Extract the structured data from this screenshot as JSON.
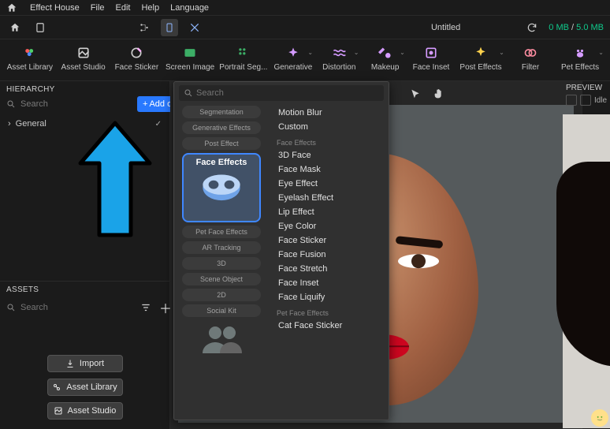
{
  "titlebar": {
    "app_name": "Effect House",
    "menus": [
      "File",
      "Edit",
      "Help",
      "Language"
    ]
  },
  "secondbar": {
    "document_title": "Untitled",
    "memory_used": "0 MB",
    "memory_total": "5.0 MB"
  },
  "categories": [
    {
      "label": "Asset Library",
      "icon": "asset-library-icon",
      "chev": false
    },
    {
      "label": "Asset Studio",
      "icon": "asset-studio-icon",
      "chev": false
    },
    {
      "label": "Face Sticker",
      "icon": "face-sticker-icon",
      "chev": false
    },
    {
      "label": "Screen Image",
      "icon": "screen-image-icon",
      "chev": false
    },
    {
      "label": "Portrait Seg...",
      "icon": "portrait-seg-icon",
      "chev": false
    },
    {
      "label": "Generative",
      "icon": "generative-icon",
      "chev": true
    },
    {
      "label": "Distortion",
      "icon": "distortion-icon",
      "chev": true
    },
    {
      "label": "Makeup",
      "icon": "makeup-icon",
      "chev": true
    },
    {
      "label": "Face Inset",
      "icon": "face-inset-icon",
      "chev": false
    },
    {
      "label": "Post Effects",
      "icon": "post-effects-icon",
      "chev": true
    },
    {
      "label": "Filter",
      "icon": "filter-icon",
      "chev": false
    },
    {
      "label": "Pet Effects",
      "icon": "pet-effects-icon",
      "chev": true
    }
  ],
  "hierarchy": {
    "title": "HIERARCHY",
    "search_placeholder": "Search",
    "add_label": "Add object",
    "items": [
      {
        "label": "General"
      }
    ]
  },
  "assets": {
    "title": "ASSETS",
    "search_placeholder": "Search",
    "buttons": {
      "import": "Import",
      "library": "Asset Library",
      "studio": "Asset Studio"
    }
  },
  "popover": {
    "search_placeholder": "Search",
    "left_stack": {
      "above": [
        "Segmentation",
        "Generative Effects",
        "Post Effect"
      ],
      "selected": "Face Effects",
      "below": [
        "Pet Face Effects",
        "AR Tracking",
        "3D",
        "Scene Object",
        "2D",
        "Social Kit"
      ]
    },
    "right": {
      "pre_items": [
        "Motion Blur",
        "Custom"
      ],
      "groups": [
        {
          "header": "Face Effects",
          "items": [
            "3D Face",
            "Face Mask",
            "Eye Effect",
            "Eyelash Effect",
            "Lip Effect",
            "Eye Color",
            "Face Sticker",
            "Face Fusion",
            "Face Stretch",
            "Face Inset",
            "Face Liquify"
          ]
        },
        {
          "header": "Pet Face Effects",
          "items": [
            "Cat Face Sticker"
          ]
        }
      ]
    }
  },
  "preview": {
    "title": "PREVIEW",
    "status": "Idle"
  },
  "colors": {
    "accent": "#2979ff",
    "arrow": "#1aa3e8"
  }
}
